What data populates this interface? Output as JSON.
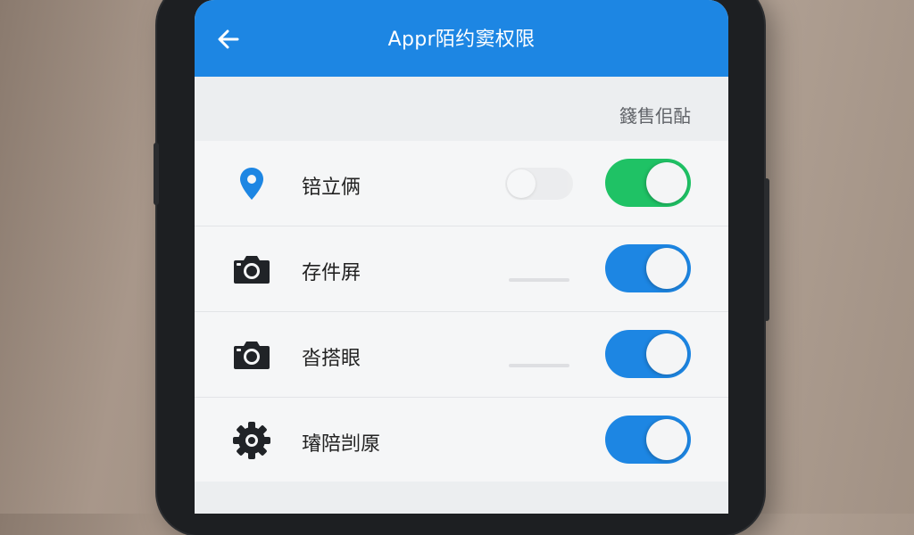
{
  "header": {
    "title": "Appr陌约窦权限",
    "back_icon": "arrow-left-icon",
    "color": "#1d86e3"
  },
  "section": {
    "label": "籛售佀酟"
  },
  "permissions": [
    {
      "label": "锫立俩",
      "icon": "location-pin-icon",
      "enabled": true,
      "toggle_color": "#1fc265"
    },
    {
      "label": "存件屛",
      "icon": "camera-icon",
      "enabled": true,
      "toggle_color": "#1d86e3"
    },
    {
      "label": "沓搭眼",
      "icon": "camera-icon",
      "enabled": true,
      "toggle_color": "#1d86e3"
    },
    {
      "label": "璿陪剀厡",
      "icon": "gear-icon",
      "enabled": true,
      "toggle_color": "#1d86e3"
    }
  ]
}
